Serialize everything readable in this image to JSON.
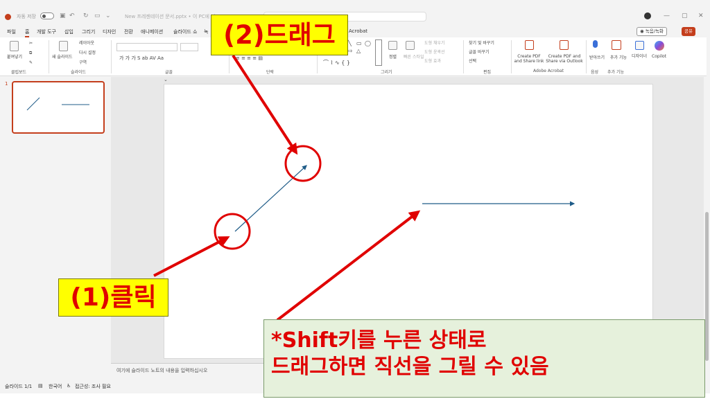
{
  "titlebar": {
    "autosave": "자동 저장",
    "document_title": "New 프레젠테이션 문서.pptx • 이 PC에 저…",
    "window_controls": [
      "—",
      "▢",
      "✕"
    ]
  },
  "tabs": [
    "파일",
    "홈",
    "개발 도구",
    "삽입",
    "그리기",
    "디자인",
    "전환",
    "애니메이션",
    "슬라이드 쇼",
    "녹",
    "Acrobat"
  ],
  "header_buttons": {
    "record": "◉ 녹음/녹화",
    "share": "공유"
  },
  "ribbon": {
    "clipboard": {
      "paste": "붙여넣기",
      "label": "클립보드"
    },
    "slides": {
      "new_slide": "새 슬라이드",
      "layout": "레이아웃",
      "reset": "다시 설정",
      "section": "구역",
      "label": "슬라이드"
    },
    "font": {
      "label": "글꼴"
    },
    "paragraph": {
      "label": "단락"
    },
    "drawing": {
      "arrange": "정렬",
      "quick_styles": "빠른 스타일",
      "shape_fill": "도형 채우기",
      "shape_outline": "도형 윤곽선",
      "shape_effects": "도형 효과",
      "label": "그리기"
    },
    "editing": {
      "find": "찾기 및 바꾸기",
      "replace": "글꼴 바꾸기",
      "select": "선택",
      "label": "편집"
    },
    "acrobat": {
      "create_pdf": "Create PDF and Share link",
      "create_pdf_outlook": "Create PDF and Share via Outlook",
      "label": "Adobe Acrobat"
    },
    "voice": {
      "dictate": "받아쓰기",
      "label": "음성"
    },
    "addins": {
      "addins": "추가 기능",
      "label": "추가 기능"
    },
    "designer": "디자이너",
    "copilot": "Copilot"
  },
  "thumbnail": {
    "number": "1"
  },
  "notes_placeholder": "여기에 슬라이드 노트의 내용을 입력하십시오",
  "statusbar": {
    "slide": "슬라이드 1/1",
    "language": "한국어",
    "accessibility": "접근성: 조사 필요"
  },
  "annotations": {
    "drag_label": "(2)드래그",
    "click_label": "(1)클릭",
    "note_line1": "*Shift키를 누른 상태로",
    "note_line2": "드래그하면 직선을 그릴 수 있음"
  },
  "colors": {
    "accent": "#c43e1c",
    "line": "#1f5c88",
    "annotation_red": "#e00000",
    "callout_yellow": "#ffff00",
    "note_green": "#e6f1dc"
  }
}
